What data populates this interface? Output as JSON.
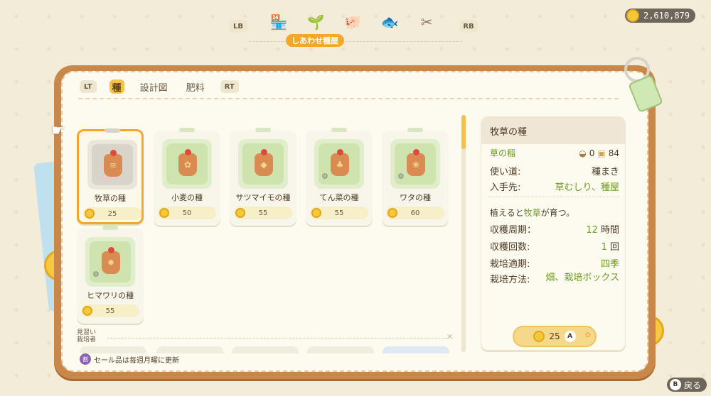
{
  "header": {
    "lb": "LB",
    "rb": "RB",
    "shop_title": "しあわせ種屋",
    "categories": [
      {
        "icon": "store-icon",
        "glyph": "🏪"
      },
      {
        "icon": "sprout-icon",
        "glyph": "🌱"
      },
      {
        "icon": "pig-icon",
        "glyph": "🐖"
      },
      {
        "icon": "fish-icon",
        "glyph": "🐟"
      },
      {
        "icon": "tools-icon",
        "glyph": "✂"
      }
    ],
    "gold": "2,610,879"
  },
  "tabs": {
    "lt": "LT",
    "rt": "RT",
    "items": [
      "種",
      "設計図",
      "肥料"
    ],
    "active_index": 0
  },
  "items": [
    {
      "name": "牧草の種",
      "price": "25",
      "glyph": "≋",
      "selected": true
    },
    {
      "name": "小麦の種",
      "price": "50",
      "glyph": "✿"
    },
    {
      "name": "サツマイモの種",
      "price": "55",
      "glyph": "◆"
    },
    {
      "name": "てん菜の種",
      "price": "55",
      "glyph": "♣",
      "locked": true
    },
    {
      "name": "ワタの種",
      "price": "60",
      "glyph": "❀",
      "locked": true
    },
    {
      "name": "ヒマワリの種",
      "price": "55",
      "glyph": "✹",
      "locked": true
    }
  ],
  "section": {
    "label_line1": "見習い",
    "label_line2": "栽培者",
    "close": "✕"
  },
  "footer_note": {
    "badge": "割",
    "text": "セール品は毎週月曜に更新"
  },
  "detail": {
    "title": "牧草の種",
    "product": "草の稲",
    "owned_bag": "0",
    "owned_box": "84",
    "usage_label": "使い道:",
    "usage_value": "種まき",
    "source_label": "入手先:",
    "source_value": "草むしり、種屋",
    "desc_prefix": "植えると",
    "desc_item": "牧草",
    "desc_suffix": "が育つ。",
    "cycle_label": "収穫周期：",
    "cycle_value": "12",
    "cycle_unit": "時間",
    "count_label": "収穫回数:",
    "count_value": "1",
    "count_unit": "回",
    "season_label": "栽培適期:",
    "season_value": "四季",
    "method_label": "栽培方法:",
    "method_value": "畑、栽培ボックス",
    "buy_price": "25",
    "buy_button": "A"
  },
  "back": {
    "button": "B",
    "label": "戻る"
  },
  "colors": {
    "accent": "#f4a82b",
    "green": "#6a9a22",
    "board": "#c9884a"
  }
}
